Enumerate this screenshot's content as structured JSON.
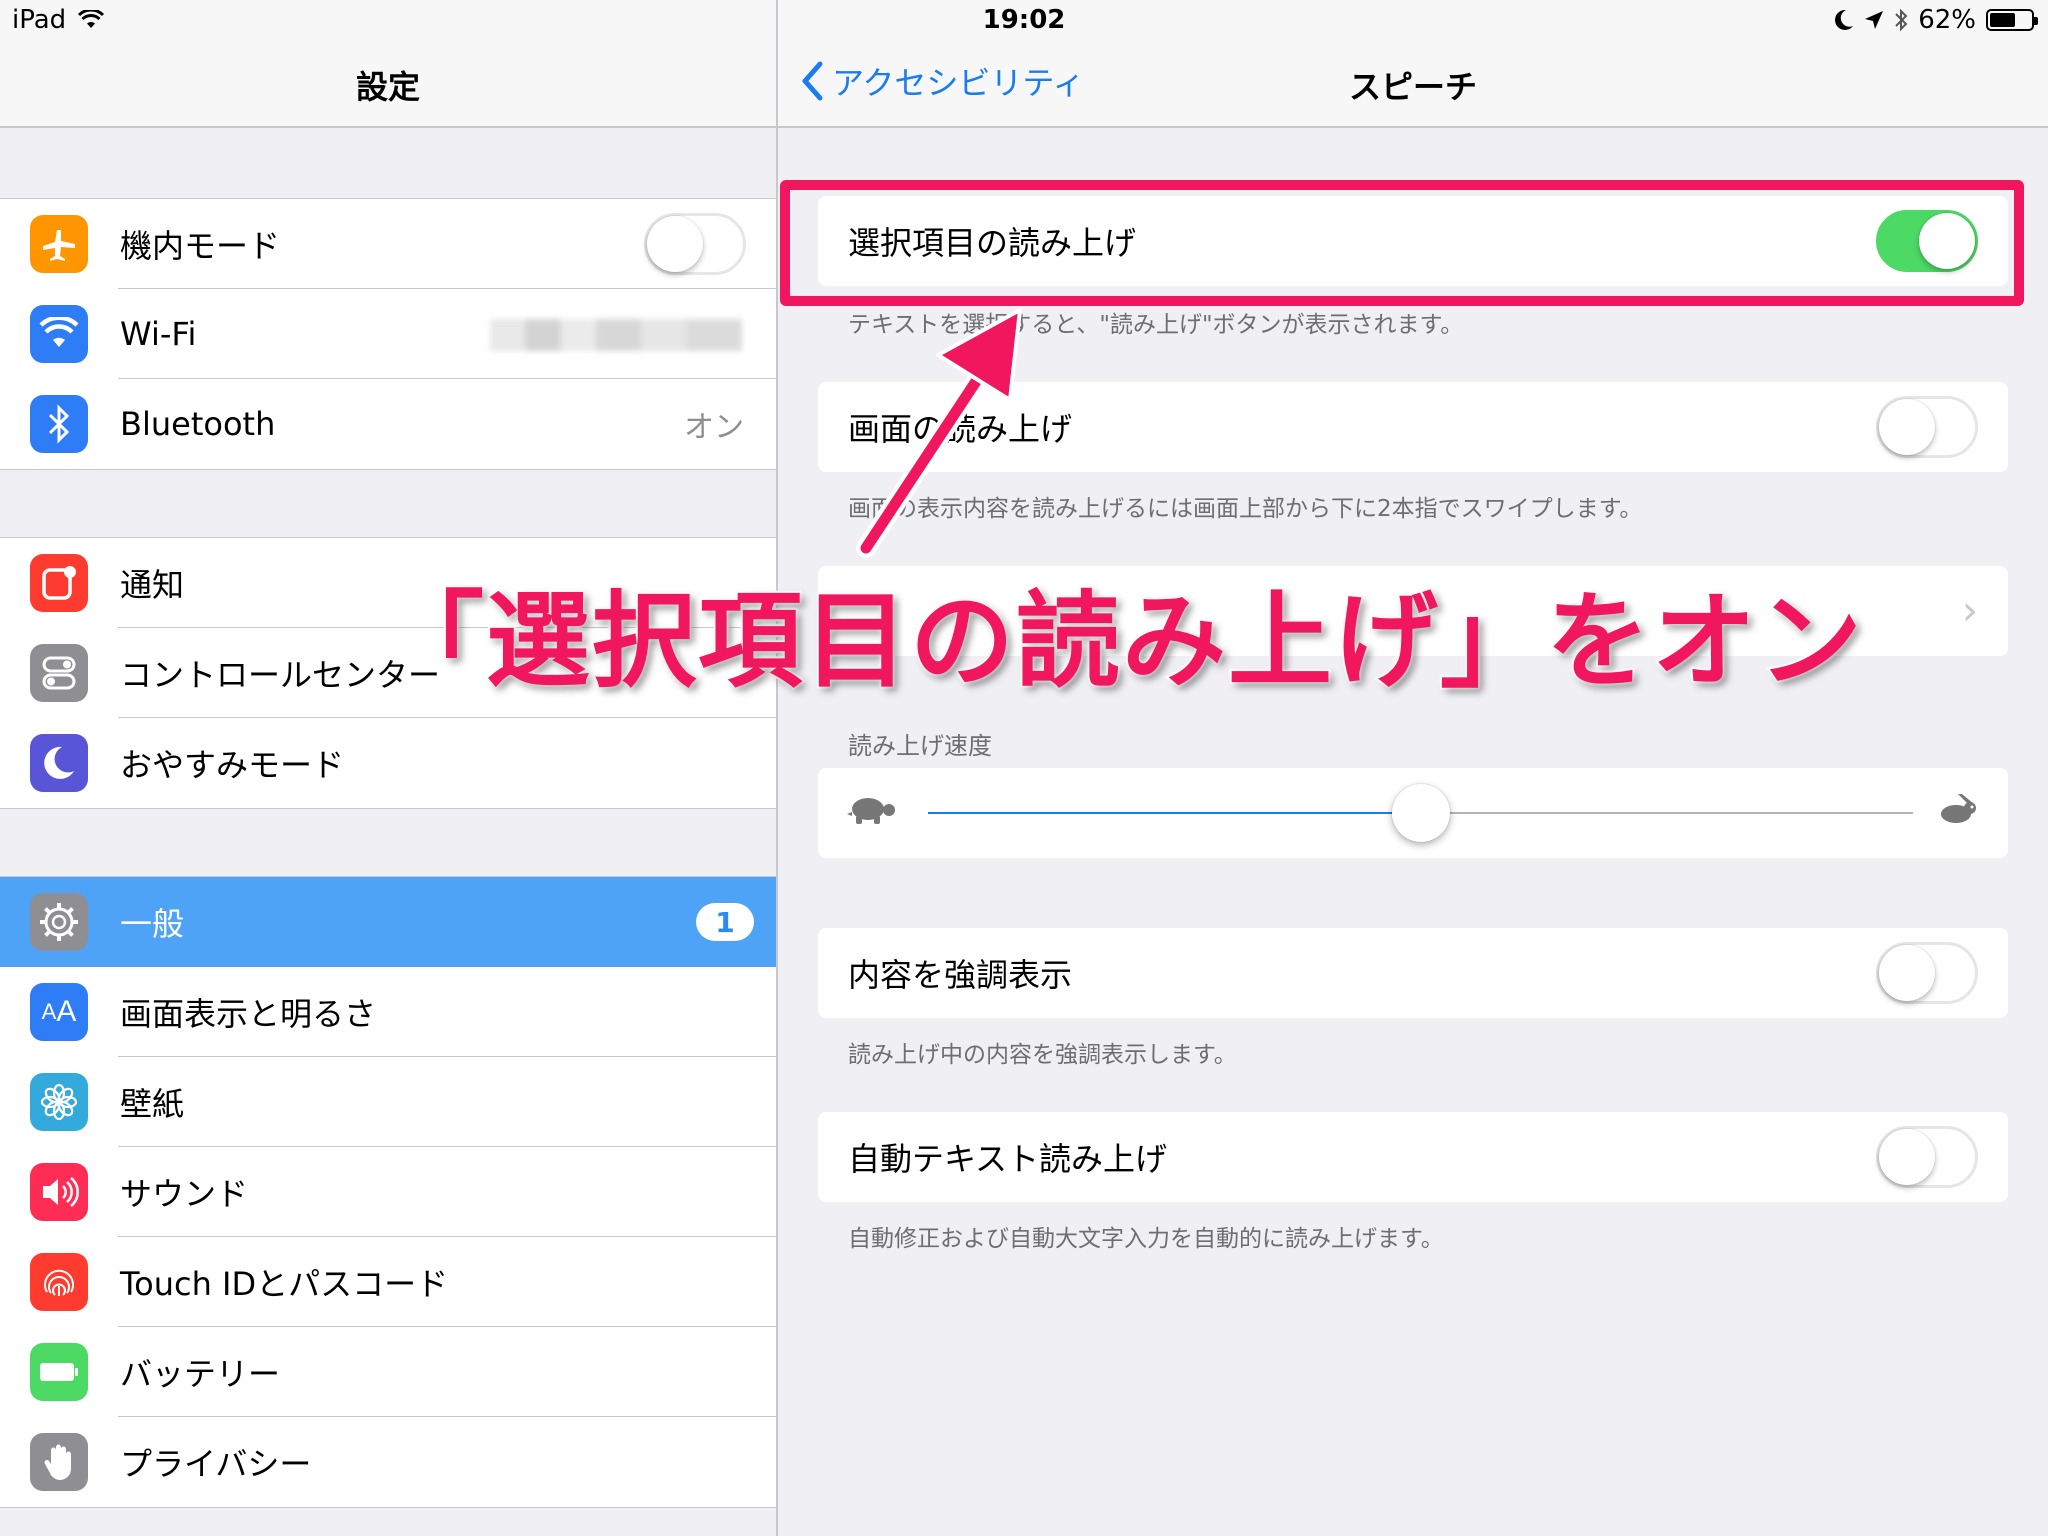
{
  "status_bar": {
    "device": "iPad",
    "time": "19:02",
    "battery_percent": "62%",
    "battery_level": 0.62
  },
  "left": {
    "title": "設定",
    "groups": [
      [
        {
          "label": "機内モード",
          "icon": "airplane-icon",
          "color": "#ff9500",
          "toggle": false
        },
        {
          "label": "Wi-Fi",
          "icon": "wifi-icon",
          "color": "#2e7cf6",
          "value": ""
        },
        {
          "label": "Bluetooth",
          "icon": "bluetooth-icon",
          "color": "#2e7cf6",
          "value": "オン"
        }
      ],
      [
        {
          "label": "通知",
          "icon": "notification-icon",
          "color": "#ff3b30"
        },
        {
          "label": "コントロールセンター",
          "icon": "control-center-icon",
          "color": "#8e8e93"
        },
        {
          "label": "おやすみモード",
          "icon": "moon-icon",
          "color": "#5856d6"
        }
      ],
      [
        {
          "label": "一般",
          "icon": "gear-icon",
          "color": "#8e8e93",
          "badge": "1",
          "selected": true
        },
        {
          "label": "画面表示と明るさ",
          "icon": "display-icon",
          "color": "#2e7cf6"
        },
        {
          "label": "壁紙",
          "icon": "wallpaper-icon",
          "color": "#34aadc"
        },
        {
          "label": "サウンド",
          "icon": "sound-icon",
          "color": "#ff2d55"
        },
        {
          "label": "Touch IDとパスコード",
          "icon": "fingerprint-icon",
          "color": "#ff3b30"
        },
        {
          "label": "バッテリー",
          "icon": "battery-icon",
          "color": "#4cd964"
        },
        {
          "label": "プライバシー",
          "icon": "hand-icon",
          "color": "#8e8e93"
        }
      ]
    ]
  },
  "right": {
    "back_label": "アクセシビリティ",
    "title": "スピーチ",
    "speak_selection": {
      "label": "選択項目の読み上げ",
      "on": true,
      "footnote": "テキストを選択すると、\"読み上げ\"ボタンが表示されます。"
    },
    "speak_screen": {
      "label": "画面の読み上げ",
      "on": false,
      "footnote": "画面の表示内容を読み上げるには画面上部から下に2本指でスワイプします。"
    },
    "voices_row": {
      "label": ""
    },
    "speaking_rate": {
      "header": "読み上げ速度",
      "value": 0.5
    },
    "highlight_content": {
      "label": "内容を強調表示",
      "on": false,
      "footnote": "読み上げ中の内容を強調表示します。"
    },
    "auto_text": {
      "label": "自動テキスト読み上げ",
      "on": false,
      "footnote": "自動修正および自動大文字入力を自動的に読み上げます。"
    }
  },
  "annotation": {
    "caption": "「選択項目の読み上げ」をオン",
    "color": "#f0175f"
  }
}
